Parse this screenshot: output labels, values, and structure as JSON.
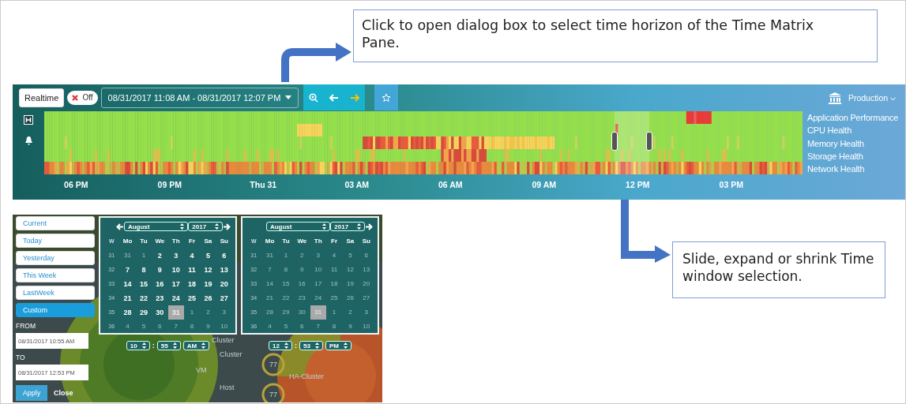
{
  "callouts": [
    {
      "text": "Click to open dialog box to select time horizon of the Time Matrix Pane."
    },
    {
      "text": "Slide, expand or shrink Time window selection."
    }
  ],
  "toolbar": {
    "realtime_button": "Realtime",
    "realtime_toggle": {
      "label": "Off",
      "on": false
    },
    "date_range": "08/31/2017 11:08 AM - 08/31/2017 12:07 PM",
    "environment": "Production"
  },
  "health_rows": [
    "Application Performance",
    "CPU Health",
    "Memory Health",
    "Storage Health",
    "Network Health"
  ],
  "time_axis": [
    "06 PM",
    "09 PM",
    "Thu 31",
    "03 AM",
    "06 AM",
    "09 AM",
    "12 PM",
    "03 PM"
  ],
  "dialog": {
    "presets": [
      {
        "label": "Current",
        "selected": false
      },
      {
        "label": "Today",
        "selected": false
      },
      {
        "label": "Yesterday",
        "selected": false
      },
      {
        "label": "This Week",
        "selected": false
      },
      {
        "label": "LastWeek",
        "selected": false
      },
      {
        "label": "Custom",
        "selected": true
      }
    ],
    "from_label": "FROM",
    "from_value": "08/31/2017 10:55 AM",
    "to_label": "TO",
    "to_value": "08/31/2017 12:53 PM",
    "apply": "Apply",
    "close": "Close",
    "calendars": [
      {
        "prev_arrow": true,
        "month": "August",
        "year": "2017",
        "headers": [
          "W",
          "Mo",
          "Tu",
          "We",
          "Th",
          "Fr",
          "Sa",
          "Su"
        ],
        "time": {
          "hour": "10",
          "separator": ":",
          "minute": "55",
          "period": "AM"
        },
        "weeks": [
          {
            "week": "31",
            "days": [
              {
                "text": "31",
                "muted": true,
                "selected": false
              },
              {
                "text": "1",
                "muted": true,
                "selected": false
              },
              {
                "text": "2",
                "muted": false,
                "selected": false
              },
              {
                "text": "3",
                "muted": false,
                "selected": false
              },
              {
                "text": "4",
                "muted": false,
                "selected": false
              },
              {
                "text": "5",
                "muted": false,
                "selected": false
              },
              {
                "text": "6",
                "muted": false,
                "selected": false
              }
            ]
          },
          {
            "week": "32",
            "days": [
              {
                "text": "7",
                "muted": false,
                "selected": false
              },
              {
                "text": "8",
                "muted": false,
                "selected": false
              },
              {
                "text": "9",
                "muted": false,
                "selected": false
              },
              {
                "text": "10",
                "muted": false,
                "selected": false
              },
              {
                "text": "11",
                "muted": false,
                "selected": false
              },
              {
                "text": "12",
                "muted": false,
                "selected": false
              },
              {
                "text": "13",
                "muted": false,
                "selected": false
              }
            ]
          },
          {
            "week": "33",
            "days": [
              {
                "text": "14",
                "muted": false,
                "selected": false
              },
              {
                "text": "15",
                "muted": false,
                "selected": false
              },
              {
                "text": "16",
                "muted": false,
                "selected": false
              },
              {
                "text": "17",
                "muted": false,
                "selected": false
              },
              {
                "text": "18",
                "muted": false,
                "selected": false
              },
              {
                "text": "19",
                "muted": false,
                "selected": false
              },
              {
                "text": "20",
                "muted": false,
                "selected": false
              }
            ]
          },
          {
            "week": "34",
            "days": [
              {
                "text": "21",
                "muted": false,
                "selected": false
              },
              {
                "text": "22",
                "muted": false,
                "selected": false
              },
              {
                "text": "23",
                "muted": false,
                "selected": false
              },
              {
                "text": "24",
                "muted": false,
                "selected": false
              },
              {
                "text": "25",
                "muted": false,
                "selected": false
              },
              {
                "text": "26",
                "muted": false,
                "selected": false
              },
              {
                "text": "27",
                "muted": false,
                "selected": false
              }
            ]
          },
          {
            "week": "35",
            "days": [
              {
                "text": "28",
                "muted": false,
                "selected": false
              },
              {
                "text": "29",
                "muted": false,
                "selected": false
              },
              {
                "text": "30",
                "muted": false,
                "selected": false
              },
              {
                "text": "31",
                "muted": false,
                "selected": true
              },
              {
                "text": "1",
                "muted": true,
                "selected": false
              },
              {
                "text": "2",
                "muted": true,
                "selected": false
              },
              {
                "text": "3",
                "muted": true,
                "selected": false
              }
            ]
          },
          {
            "week": "36",
            "days": [
              {
                "text": "4",
                "muted": true,
                "selected": false
              },
              {
                "text": "5",
                "muted": true,
                "selected": false
              },
              {
                "text": "6",
                "muted": true,
                "selected": false
              },
              {
                "text": "7",
                "muted": true,
                "selected": false
              },
              {
                "text": "8",
                "muted": true,
                "selected": false
              },
              {
                "text": "9",
                "muted": true,
                "selected": false
              },
              {
                "text": "10",
                "muted": true,
                "selected": false
              }
            ]
          }
        ]
      },
      {
        "prev_arrow": false,
        "month": "August",
        "year": "2017",
        "headers": [
          "W",
          "Mo",
          "Tu",
          "We",
          "Th",
          "Fr",
          "Sa",
          "Su"
        ],
        "time": {
          "hour": "12",
          "separator": ":",
          "minute": "53",
          "period": "PM"
        },
        "weeks": [
          {
            "week": "31",
            "days": [
              {
                "text": "31",
                "muted": true,
                "selected": false
              },
              {
                "text": "1",
                "muted": true,
                "selected": false
              },
              {
                "text": "2",
                "muted": true,
                "selected": false
              },
              {
                "text": "3",
                "muted": true,
                "selected": false
              },
              {
                "text": "4",
                "muted": true,
                "selected": false
              },
              {
                "text": "5",
                "muted": true,
                "selected": false
              },
              {
                "text": "6",
                "muted": true,
                "selected": false
              }
            ]
          },
          {
            "week": "32",
            "days": [
              {
                "text": "7",
                "muted": true,
                "selected": false
              },
              {
                "text": "8",
                "muted": true,
                "selected": false
              },
              {
                "text": "9",
                "muted": true,
                "selected": false
              },
              {
                "text": "10",
                "muted": true,
                "selected": false
              },
              {
                "text": "11",
                "muted": true,
                "selected": false
              },
              {
                "text": "12",
                "muted": true,
                "selected": false
              },
              {
                "text": "13",
                "muted": true,
                "selected": false
              }
            ]
          },
          {
            "week": "33",
            "days": [
              {
                "text": "14",
                "muted": true,
                "selected": false
              },
              {
                "text": "15",
                "muted": true,
                "selected": false
              },
              {
                "text": "16",
                "muted": true,
                "selected": false
              },
              {
                "text": "17",
                "muted": true,
                "selected": false
              },
              {
                "text": "18",
                "muted": true,
                "selected": false
              },
              {
                "text": "19",
                "muted": true,
                "selected": false
              },
              {
                "text": "20",
                "muted": true,
                "selected": false
              }
            ]
          },
          {
            "week": "34",
            "days": [
              {
                "text": "21",
                "muted": true,
                "selected": false
              },
              {
                "text": "22",
                "muted": true,
                "selected": false
              },
              {
                "text": "23",
                "muted": true,
                "selected": false
              },
              {
                "text": "24",
                "muted": true,
                "selected": false
              },
              {
                "text": "25",
                "muted": true,
                "selected": false
              },
              {
                "text": "26",
                "muted": true,
                "selected": false
              },
              {
                "text": "27",
                "muted": true,
                "selected": false
              }
            ]
          },
          {
            "week": "35",
            "days": [
              {
                "text": "28",
                "muted": true,
                "selected": false
              },
              {
                "text": "29",
                "muted": true,
                "selected": false
              },
              {
                "text": "30",
                "muted": true,
                "selected": false
              },
              {
                "text": "31",
                "muted": true,
                "selected": true
              },
              {
                "text": "1",
                "muted": true,
                "selected": false
              },
              {
                "text": "2",
                "muted": true,
                "selected": false
              },
              {
                "text": "3",
                "muted": true,
                "selected": false
              }
            ]
          },
          {
            "week": "36",
            "days": [
              {
                "text": "4",
                "muted": true,
                "selected": false
              },
              {
                "text": "5",
                "muted": true,
                "selected": false
              },
              {
                "text": "6",
                "muted": true,
                "selected": false
              },
              {
                "text": "7",
                "muted": true,
                "selected": false
              },
              {
                "text": "8",
                "muted": true,
                "selected": false
              },
              {
                "text": "9",
                "muted": true,
                "selected": false
              },
              {
                "text": "10",
                "muted": true,
                "selected": false
              }
            ]
          }
        ]
      }
    ]
  },
  "background_labels": [
    "Cluster",
    "Cluster",
    "77",
    "HA-Cluster",
    "VM",
    "Host",
    "77"
  ]
}
